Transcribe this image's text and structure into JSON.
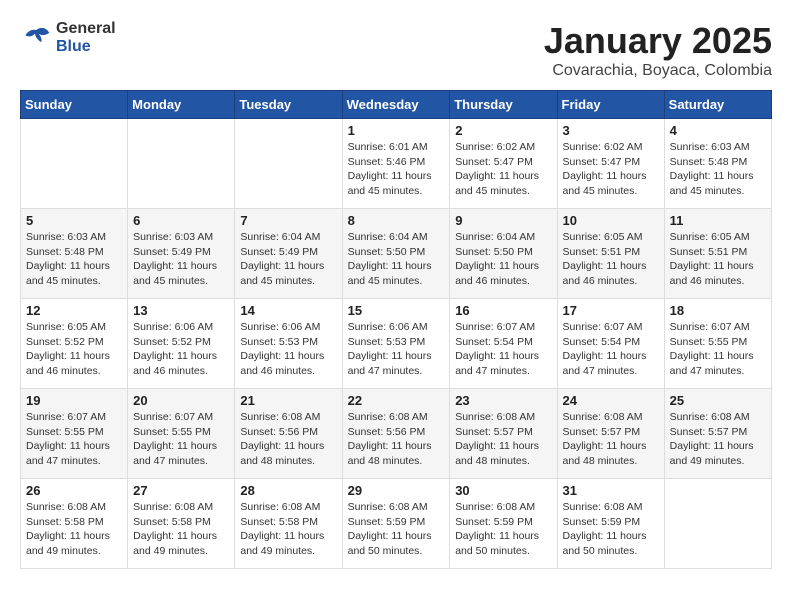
{
  "header": {
    "logo_general": "General",
    "logo_blue": "Blue",
    "month_year": "January 2025",
    "location": "Covarachia, Boyaca, Colombia"
  },
  "weekdays": [
    "Sunday",
    "Monday",
    "Tuesday",
    "Wednesday",
    "Thursday",
    "Friday",
    "Saturday"
  ],
  "weeks": [
    [
      {
        "day": "",
        "sunrise": "",
        "sunset": "",
        "daylight": ""
      },
      {
        "day": "",
        "sunrise": "",
        "sunset": "",
        "daylight": ""
      },
      {
        "day": "",
        "sunrise": "",
        "sunset": "",
        "daylight": ""
      },
      {
        "day": "1",
        "sunrise": "Sunrise: 6:01 AM",
        "sunset": "Sunset: 5:46 PM",
        "daylight": "Daylight: 11 hours and 45 minutes."
      },
      {
        "day": "2",
        "sunrise": "Sunrise: 6:02 AM",
        "sunset": "Sunset: 5:47 PM",
        "daylight": "Daylight: 11 hours and 45 minutes."
      },
      {
        "day": "3",
        "sunrise": "Sunrise: 6:02 AM",
        "sunset": "Sunset: 5:47 PM",
        "daylight": "Daylight: 11 hours and 45 minutes."
      },
      {
        "day": "4",
        "sunrise": "Sunrise: 6:03 AM",
        "sunset": "Sunset: 5:48 PM",
        "daylight": "Daylight: 11 hours and 45 minutes."
      }
    ],
    [
      {
        "day": "5",
        "sunrise": "Sunrise: 6:03 AM",
        "sunset": "Sunset: 5:48 PM",
        "daylight": "Daylight: 11 hours and 45 minutes."
      },
      {
        "day": "6",
        "sunrise": "Sunrise: 6:03 AM",
        "sunset": "Sunset: 5:49 PM",
        "daylight": "Daylight: 11 hours and 45 minutes."
      },
      {
        "day": "7",
        "sunrise": "Sunrise: 6:04 AM",
        "sunset": "Sunset: 5:49 PM",
        "daylight": "Daylight: 11 hours and 45 minutes."
      },
      {
        "day": "8",
        "sunrise": "Sunrise: 6:04 AM",
        "sunset": "Sunset: 5:50 PM",
        "daylight": "Daylight: 11 hours and 45 minutes."
      },
      {
        "day": "9",
        "sunrise": "Sunrise: 6:04 AM",
        "sunset": "Sunset: 5:50 PM",
        "daylight": "Daylight: 11 hours and 46 minutes."
      },
      {
        "day": "10",
        "sunrise": "Sunrise: 6:05 AM",
        "sunset": "Sunset: 5:51 PM",
        "daylight": "Daylight: 11 hours and 46 minutes."
      },
      {
        "day": "11",
        "sunrise": "Sunrise: 6:05 AM",
        "sunset": "Sunset: 5:51 PM",
        "daylight": "Daylight: 11 hours and 46 minutes."
      }
    ],
    [
      {
        "day": "12",
        "sunrise": "Sunrise: 6:05 AM",
        "sunset": "Sunset: 5:52 PM",
        "daylight": "Daylight: 11 hours and 46 minutes."
      },
      {
        "day": "13",
        "sunrise": "Sunrise: 6:06 AM",
        "sunset": "Sunset: 5:52 PM",
        "daylight": "Daylight: 11 hours and 46 minutes."
      },
      {
        "day": "14",
        "sunrise": "Sunrise: 6:06 AM",
        "sunset": "Sunset: 5:53 PM",
        "daylight": "Daylight: 11 hours and 46 minutes."
      },
      {
        "day": "15",
        "sunrise": "Sunrise: 6:06 AM",
        "sunset": "Sunset: 5:53 PM",
        "daylight": "Daylight: 11 hours and 47 minutes."
      },
      {
        "day": "16",
        "sunrise": "Sunrise: 6:07 AM",
        "sunset": "Sunset: 5:54 PM",
        "daylight": "Daylight: 11 hours and 47 minutes."
      },
      {
        "day": "17",
        "sunrise": "Sunrise: 6:07 AM",
        "sunset": "Sunset: 5:54 PM",
        "daylight": "Daylight: 11 hours and 47 minutes."
      },
      {
        "day": "18",
        "sunrise": "Sunrise: 6:07 AM",
        "sunset": "Sunset: 5:55 PM",
        "daylight": "Daylight: 11 hours and 47 minutes."
      }
    ],
    [
      {
        "day": "19",
        "sunrise": "Sunrise: 6:07 AM",
        "sunset": "Sunset: 5:55 PM",
        "daylight": "Daylight: 11 hours and 47 minutes."
      },
      {
        "day": "20",
        "sunrise": "Sunrise: 6:07 AM",
        "sunset": "Sunset: 5:55 PM",
        "daylight": "Daylight: 11 hours and 47 minutes."
      },
      {
        "day": "21",
        "sunrise": "Sunrise: 6:08 AM",
        "sunset": "Sunset: 5:56 PM",
        "daylight": "Daylight: 11 hours and 48 minutes."
      },
      {
        "day": "22",
        "sunrise": "Sunrise: 6:08 AM",
        "sunset": "Sunset: 5:56 PM",
        "daylight": "Daylight: 11 hours and 48 minutes."
      },
      {
        "day": "23",
        "sunrise": "Sunrise: 6:08 AM",
        "sunset": "Sunset: 5:57 PM",
        "daylight": "Daylight: 11 hours and 48 minutes."
      },
      {
        "day": "24",
        "sunrise": "Sunrise: 6:08 AM",
        "sunset": "Sunset: 5:57 PM",
        "daylight": "Daylight: 11 hours and 48 minutes."
      },
      {
        "day": "25",
        "sunrise": "Sunrise: 6:08 AM",
        "sunset": "Sunset: 5:57 PM",
        "daylight": "Daylight: 11 hours and 49 minutes."
      }
    ],
    [
      {
        "day": "26",
        "sunrise": "Sunrise: 6:08 AM",
        "sunset": "Sunset: 5:58 PM",
        "daylight": "Daylight: 11 hours and 49 minutes."
      },
      {
        "day": "27",
        "sunrise": "Sunrise: 6:08 AM",
        "sunset": "Sunset: 5:58 PM",
        "daylight": "Daylight: 11 hours and 49 minutes."
      },
      {
        "day": "28",
        "sunrise": "Sunrise: 6:08 AM",
        "sunset": "Sunset: 5:58 PM",
        "daylight": "Daylight: 11 hours and 49 minutes."
      },
      {
        "day": "29",
        "sunrise": "Sunrise: 6:08 AM",
        "sunset": "Sunset: 5:59 PM",
        "daylight": "Daylight: 11 hours and 50 minutes."
      },
      {
        "day": "30",
        "sunrise": "Sunrise: 6:08 AM",
        "sunset": "Sunset: 5:59 PM",
        "daylight": "Daylight: 11 hours and 50 minutes."
      },
      {
        "day": "31",
        "sunrise": "Sunrise: 6:08 AM",
        "sunset": "Sunset: 5:59 PM",
        "daylight": "Daylight: 11 hours and 50 minutes."
      },
      {
        "day": "",
        "sunrise": "",
        "sunset": "",
        "daylight": ""
      }
    ]
  ]
}
